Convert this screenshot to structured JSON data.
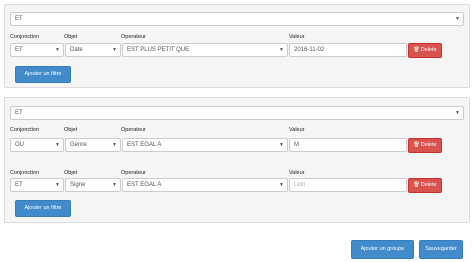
{
  "groups": [
    {
      "conjunction_select": "ET",
      "column_labels": {
        "conjunction": "Conjonction",
        "objet": "Objet",
        "operateur": "Operateur",
        "valeur": "Valeur"
      },
      "filters": [
        {
          "conjunction": "ET",
          "objet": "Date",
          "operateur": "EST PLUS PETIT QUE",
          "valeur": "2016-11-02",
          "valeur_is_placeholder": false,
          "delete_label": "Delete"
        }
      ],
      "add_filter_label": "Ajouter un filtre"
    },
    {
      "conjunction_select": "ET",
      "column_labels": {
        "conjunction": "Conjonction",
        "objet": "Objet",
        "operateur": "Operateur",
        "valeur": "Valeur"
      },
      "filters": [
        {
          "conjunction": "OU",
          "objet": "Genre",
          "operateur": "EST EGAL A",
          "valeur": "M",
          "valeur_is_placeholder": false,
          "delete_label": "Delete"
        },
        {
          "conjunction": "ET",
          "objet": "Signe",
          "operateur": "EST EGAL A",
          "valeur": "Lion",
          "valeur_is_placeholder": true,
          "delete_label": "Delete"
        }
      ],
      "add_filter_label": "Ajouter un filtre"
    }
  ],
  "footer": {
    "add_group_label": "Ajouter un groupe",
    "save_label": "Sauvegarder"
  },
  "icons": {
    "caret": "caret-down-icon",
    "trash": "trash-icon"
  },
  "colors": {
    "primary": "#428bca",
    "danger": "#d9534f",
    "panel_bg": "#f5f5f5"
  }
}
